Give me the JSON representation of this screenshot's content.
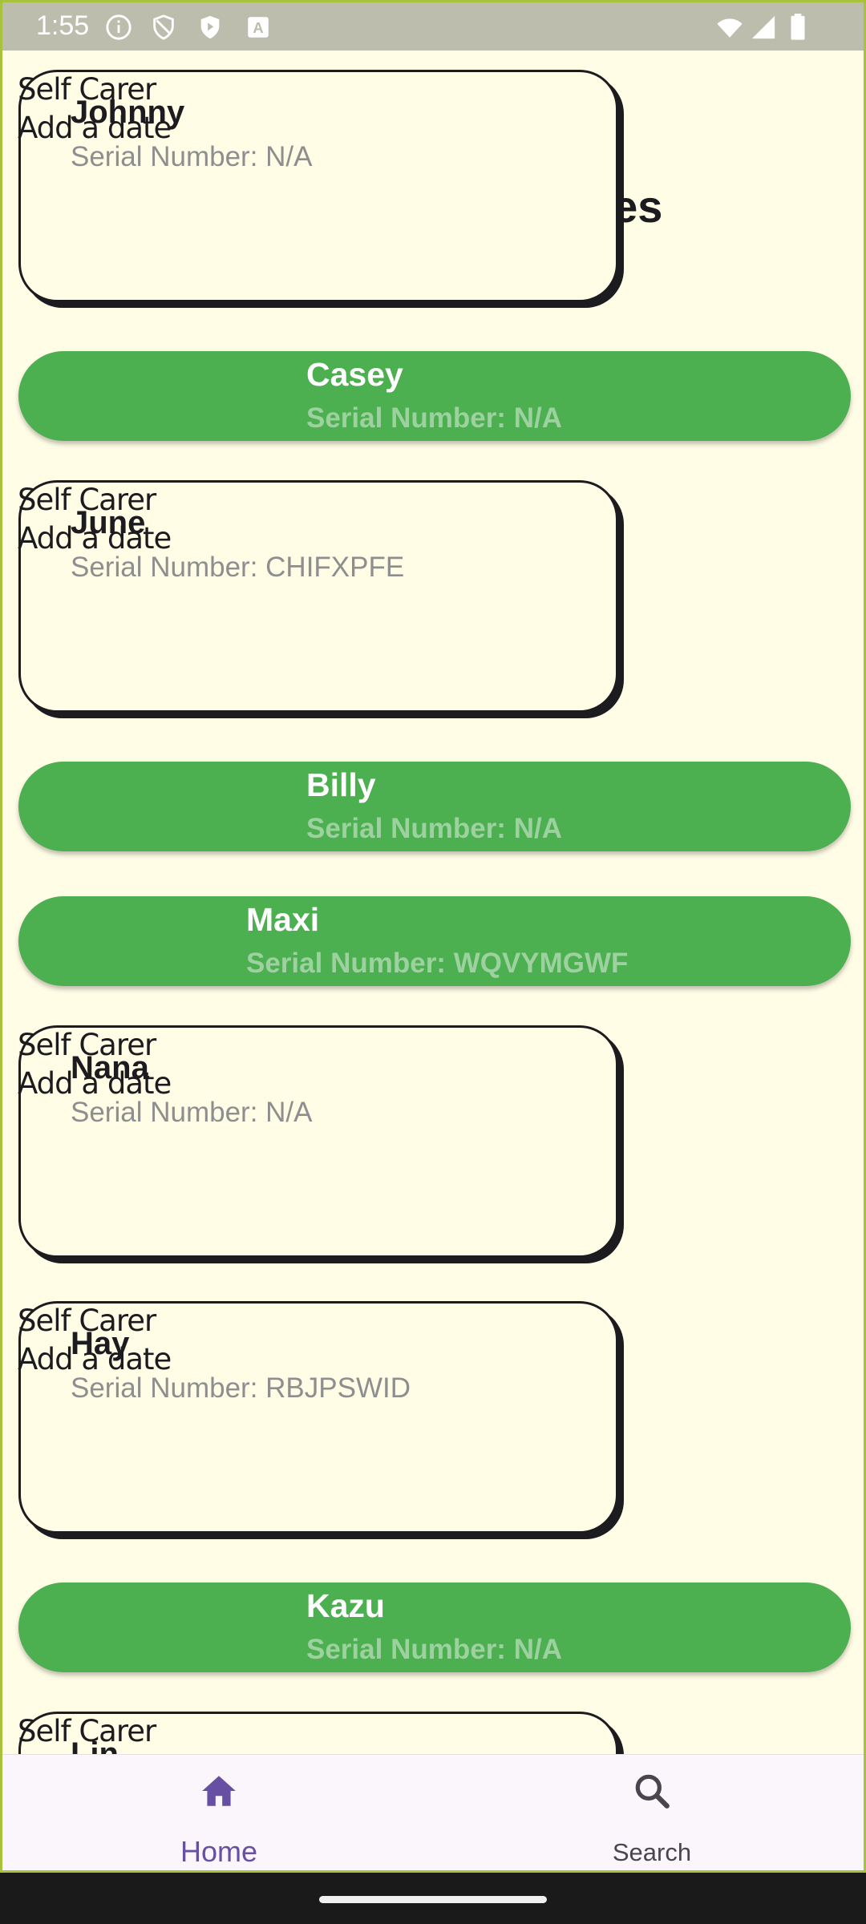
{
  "status_bar": {
    "time": "1:55",
    "left_icons": [
      "info-icon",
      "shield-outline-icon",
      "shield-play-icon",
      "text-a-icon"
    ],
    "right_icons": [
      "wifi-icon",
      "signal-icon",
      "battery-icon"
    ]
  },
  "background_title": "kes",
  "cards": [
    {
      "name": "Johnny",
      "serial": "Serial Number: N/A",
      "role": "Self Carer",
      "date": "Add a date"
    },
    {
      "name": "June",
      "serial": "Serial Number: CHIFXPFE",
      "role": "Self Carer",
      "date": "Add a date"
    },
    {
      "name": "Nana",
      "serial": "Serial Number: N/A",
      "role": "Self Carer",
      "date": "Add a date"
    },
    {
      "name": "Hay",
      "serial": "Serial Number: RBJPSWID",
      "role": "Self Carer",
      "date": "Add a date"
    },
    {
      "name": "Lin",
      "serial": "",
      "role": "Self Carer",
      "date": ""
    }
  ],
  "pills": [
    {
      "name": "Casey",
      "serial": "Serial Number: N/A"
    },
    {
      "name": "Billy",
      "serial": "Serial Number: N/A"
    },
    {
      "name": "Maxi",
      "serial": "Serial Number: WQVYMGWF"
    },
    {
      "name": "Kazu",
      "serial": "Serial Number: N/A"
    }
  ],
  "nav": {
    "home_label": "Home",
    "search_label": "Search",
    "active": "Home"
  },
  "colors": {
    "background": "#fffde6",
    "accent_green": "#4caf50",
    "nav_active": "#6750a4"
  }
}
